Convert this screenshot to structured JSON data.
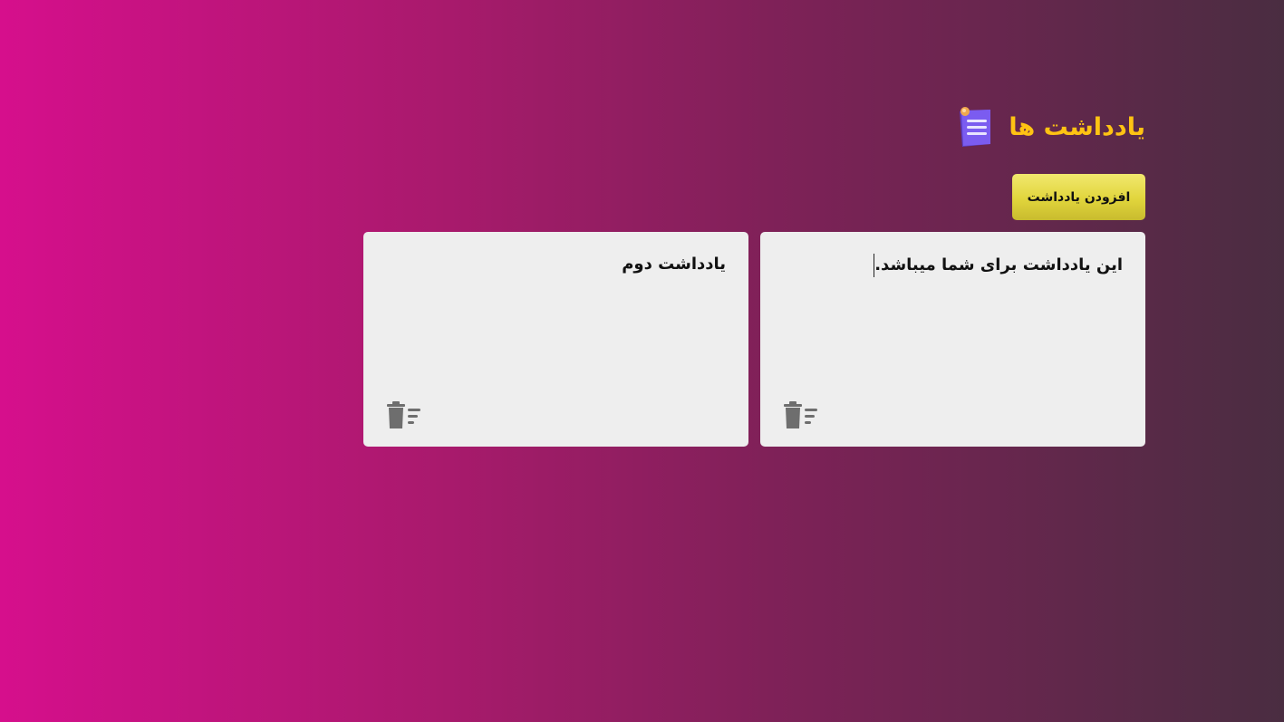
{
  "header": {
    "title": "یادداشت ها",
    "icon": "notes-app-icon"
  },
  "toolbar": {
    "add_label": "افزودن یادداشت"
  },
  "notes": [
    {
      "text": "این یادداشت برای شما میباشد.",
      "focused": true,
      "delete_icon": "delete-note-icon"
    },
    {
      "text": "یادداشت دوم",
      "focused": false,
      "delete_icon": "delete-note-icon"
    }
  ],
  "colors": {
    "bg_start": "#d60f8c",
    "bg_end": "#4a2d41",
    "title": "#ffc313",
    "button": "#e1d53c",
    "note_bg": "#eeeeee",
    "icon_gray": "#6e6e6e"
  }
}
